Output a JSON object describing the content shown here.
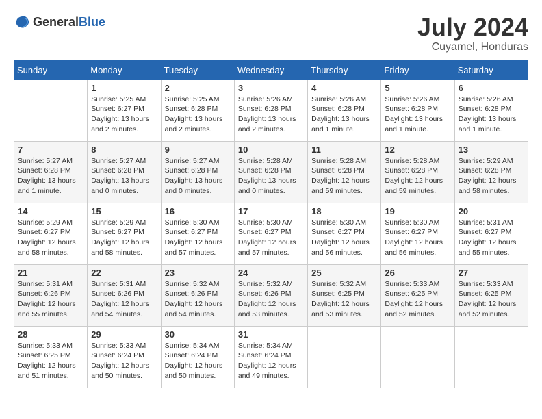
{
  "header": {
    "logo_general": "General",
    "logo_blue": "Blue",
    "month_year": "July 2024",
    "location": "Cuyamel, Honduras"
  },
  "columns": [
    "Sunday",
    "Monday",
    "Tuesday",
    "Wednesday",
    "Thursday",
    "Friday",
    "Saturday"
  ],
  "weeks": [
    [
      {
        "day": "",
        "sunrise": "",
        "sunset": "",
        "daylight": ""
      },
      {
        "day": "1",
        "sunrise": "Sunrise: 5:25 AM",
        "sunset": "Sunset: 6:27 PM",
        "daylight": "Daylight: 13 hours and 2 minutes."
      },
      {
        "day": "2",
        "sunrise": "Sunrise: 5:25 AM",
        "sunset": "Sunset: 6:28 PM",
        "daylight": "Daylight: 13 hours and 2 minutes."
      },
      {
        "day": "3",
        "sunrise": "Sunrise: 5:26 AM",
        "sunset": "Sunset: 6:28 PM",
        "daylight": "Daylight: 13 hours and 2 minutes."
      },
      {
        "day": "4",
        "sunrise": "Sunrise: 5:26 AM",
        "sunset": "Sunset: 6:28 PM",
        "daylight": "Daylight: 13 hours and 1 minute."
      },
      {
        "day": "5",
        "sunrise": "Sunrise: 5:26 AM",
        "sunset": "Sunset: 6:28 PM",
        "daylight": "Daylight: 13 hours and 1 minute."
      },
      {
        "day": "6",
        "sunrise": "Sunrise: 5:26 AM",
        "sunset": "Sunset: 6:28 PM",
        "daylight": "Daylight: 13 hours and 1 minute."
      }
    ],
    [
      {
        "day": "7",
        "sunrise": "Sunrise: 5:27 AM",
        "sunset": "Sunset: 6:28 PM",
        "daylight": "Daylight: 13 hours and 1 minute."
      },
      {
        "day": "8",
        "sunrise": "Sunrise: 5:27 AM",
        "sunset": "Sunset: 6:28 PM",
        "daylight": "Daylight: 13 hours and 0 minutes."
      },
      {
        "day": "9",
        "sunrise": "Sunrise: 5:27 AM",
        "sunset": "Sunset: 6:28 PM",
        "daylight": "Daylight: 13 hours and 0 minutes."
      },
      {
        "day": "10",
        "sunrise": "Sunrise: 5:28 AM",
        "sunset": "Sunset: 6:28 PM",
        "daylight": "Daylight: 13 hours and 0 minutes."
      },
      {
        "day": "11",
        "sunrise": "Sunrise: 5:28 AM",
        "sunset": "Sunset: 6:28 PM",
        "daylight": "Daylight: 12 hours and 59 minutes."
      },
      {
        "day": "12",
        "sunrise": "Sunrise: 5:28 AM",
        "sunset": "Sunset: 6:28 PM",
        "daylight": "Daylight: 12 hours and 59 minutes."
      },
      {
        "day": "13",
        "sunrise": "Sunrise: 5:29 AM",
        "sunset": "Sunset: 6:28 PM",
        "daylight": "Daylight: 12 hours and 58 minutes."
      }
    ],
    [
      {
        "day": "14",
        "sunrise": "Sunrise: 5:29 AM",
        "sunset": "Sunset: 6:27 PM",
        "daylight": "Daylight: 12 hours and 58 minutes."
      },
      {
        "day": "15",
        "sunrise": "Sunrise: 5:29 AM",
        "sunset": "Sunset: 6:27 PM",
        "daylight": "Daylight: 12 hours and 58 minutes."
      },
      {
        "day": "16",
        "sunrise": "Sunrise: 5:30 AM",
        "sunset": "Sunset: 6:27 PM",
        "daylight": "Daylight: 12 hours and 57 minutes."
      },
      {
        "day": "17",
        "sunrise": "Sunrise: 5:30 AM",
        "sunset": "Sunset: 6:27 PM",
        "daylight": "Daylight: 12 hours and 57 minutes."
      },
      {
        "day": "18",
        "sunrise": "Sunrise: 5:30 AM",
        "sunset": "Sunset: 6:27 PM",
        "daylight": "Daylight: 12 hours and 56 minutes."
      },
      {
        "day": "19",
        "sunrise": "Sunrise: 5:30 AM",
        "sunset": "Sunset: 6:27 PM",
        "daylight": "Daylight: 12 hours and 56 minutes."
      },
      {
        "day": "20",
        "sunrise": "Sunrise: 5:31 AM",
        "sunset": "Sunset: 6:27 PM",
        "daylight": "Daylight: 12 hours and 55 minutes."
      }
    ],
    [
      {
        "day": "21",
        "sunrise": "Sunrise: 5:31 AM",
        "sunset": "Sunset: 6:26 PM",
        "daylight": "Daylight: 12 hours and 55 minutes."
      },
      {
        "day": "22",
        "sunrise": "Sunrise: 5:31 AM",
        "sunset": "Sunset: 6:26 PM",
        "daylight": "Daylight: 12 hours and 54 minutes."
      },
      {
        "day": "23",
        "sunrise": "Sunrise: 5:32 AM",
        "sunset": "Sunset: 6:26 PM",
        "daylight": "Daylight: 12 hours and 54 minutes."
      },
      {
        "day": "24",
        "sunrise": "Sunrise: 5:32 AM",
        "sunset": "Sunset: 6:26 PM",
        "daylight": "Daylight: 12 hours and 53 minutes."
      },
      {
        "day": "25",
        "sunrise": "Sunrise: 5:32 AM",
        "sunset": "Sunset: 6:25 PM",
        "daylight": "Daylight: 12 hours and 53 minutes."
      },
      {
        "day": "26",
        "sunrise": "Sunrise: 5:33 AM",
        "sunset": "Sunset: 6:25 PM",
        "daylight": "Daylight: 12 hours and 52 minutes."
      },
      {
        "day": "27",
        "sunrise": "Sunrise: 5:33 AM",
        "sunset": "Sunset: 6:25 PM",
        "daylight": "Daylight: 12 hours and 52 minutes."
      }
    ],
    [
      {
        "day": "28",
        "sunrise": "Sunrise: 5:33 AM",
        "sunset": "Sunset: 6:25 PM",
        "daylight": "Daylight: 12 hours and 51 minutes."
      },
      {
        "day": "29",
        "sunrise": "Sunrise: 5:33 AM",
        "sunset": "Sunset: 6:24 PM",
        "daylight": "Daylight: 12 hours and 50 minutes."
      },
      {
        "day": "30",
        "sunrise": "Sunrise: 5:34 AM",
        "sunset": "Sunset: 6:24 PM",
        "daylight": "Daylight: 12 hours and 50 minutes."
      },
      {
        "day": "31",
        "sunrise": "Sunrise: 5:34 AM",
        "sunset": "Sunset: 6:24 PM",
        "daylight": "Daylight: 12 hours and 49 minutes."
      },
      {
        "day": "",
        "sunrise": "",
        "sunset": "",
        "daylight": ""
      },
      {
        "day": "",
        "sunrise": "",
        "sunset": "",
        "daylight": ""
      },
      {
        "day": "",
        "sunrise": "",
        "sunset": "",
        "daylight": ""
      }
    ]
  ]
}
